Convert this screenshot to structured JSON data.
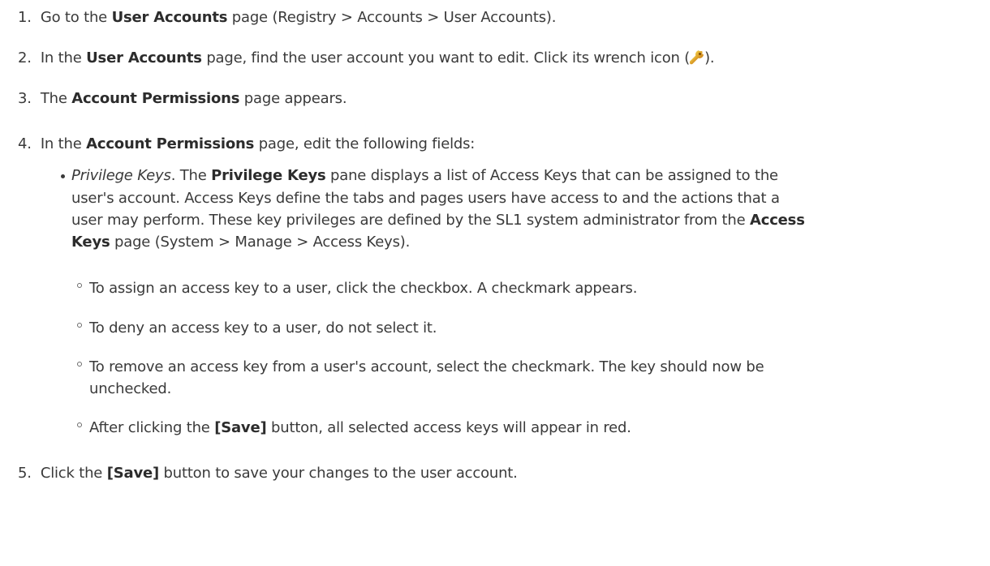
{
  "steps": [
    {
      "num": "1.",
      "a": "Go to the ",
      "b": "User Accounts",
      "c": " page (Registry > Accounts > User Accounts)."
    },
    {
      "num": "2.",
      "a": "In the ",
      "b": "User Accounts",
      "c": " page, find the user account you want to edit. Click its wrench icon (",
      "d": ")."
    },
    {
      "num": "3.",
      "a": "The ",
      "b": "Account Permissions",
      "c": " page appears."
    },
    {
      "num": "4.",
      "a": "In the ",
      "b": "Account Permissions",
      "c": " page, edit the following fields:"
    },
    {
      "num": "5.",
      "a": "Click the ",
      "b": "[Save]",
      "c": " button to save your changes to the user account."
    }
  ],
  "privilege": {
    "term": "Privilege Keys",
    "p1": ". The ",
    "p2": "Privilege Keys",
    "p3": " pane displays a list of Access Keys that can be assigned to the",
    "line2": "user's account. Access Keys define the tabs and pages users have access to and the actions that a",
    "line3a": "user may perform. These key privileges are defined by the SL1 system administrator from the ",
    "line3b": "Access",
    "line4a": "Keys",
    "line4b": " page (System > Manage > Access Keys)."
  },
  "subbullets": {
    "s1": "To assign an access key to a user, click the checkbox. A checkmark appears.",
    "s2": "To deny an access key to a user, do not select it.",
    "s3a": "To remove an access key from a user's account, select the checkmark. The key should now be",
    "s3b": "unchecked.",
    "s4a": "After clicking the ",
    "s4b": "[Save]",
    "s4c": " button, all selected access keys will appear in red."
  },
  "icons": {
    "wrench": "wrench-icon"
  }
}
